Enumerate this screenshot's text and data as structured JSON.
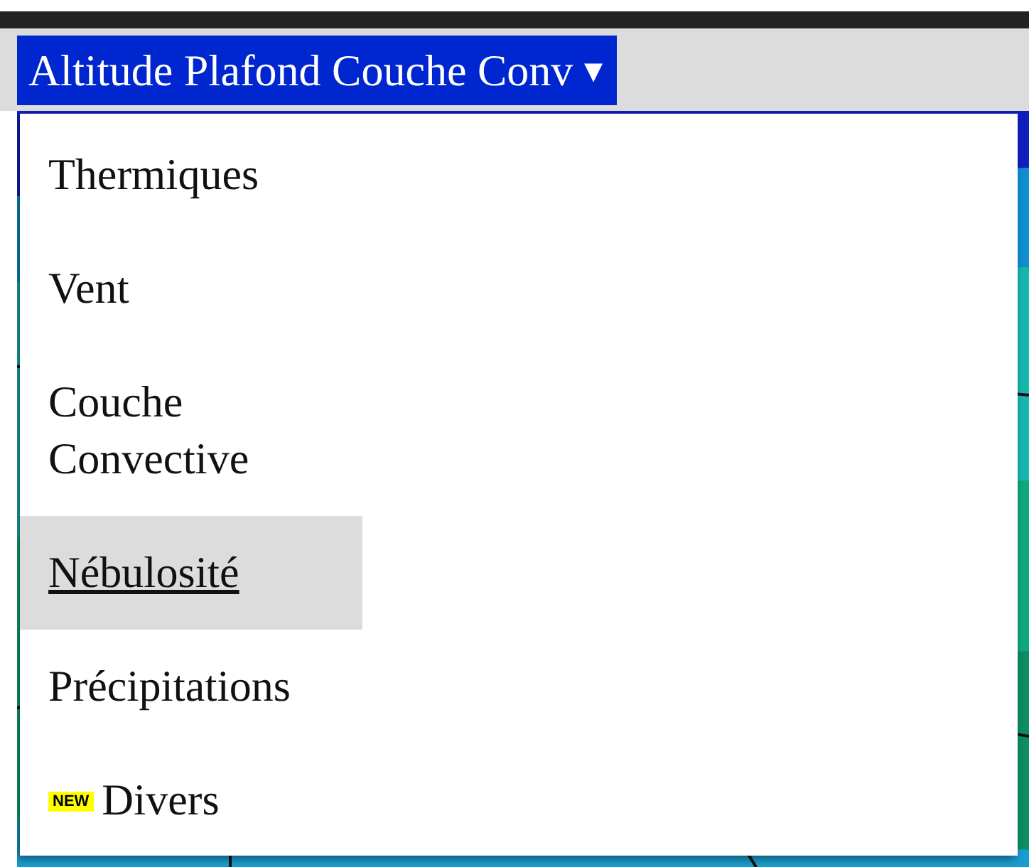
{
  "dropdown": {
    "label": "Altitude Plafond Couche Conv",
    "caret": "▾",
    "expanded": true
  },
  "menu": {
    "items": [
      {
        "label": "Thermiques",
        "selected": false
      },
      {
        "label": "Vent",
        "selected": false
      },
      {
        "label": "Couche Convective",
        "selected": false
      },
      {
        "label": "Nébulosité",
        "selected": true
      },
      {
        "label": "Précipitations",
        "selected": false
      },
      {
        "label": "Divers",
        "selected": false,
        "badge": "NEW"
      }
    ]
  }
}
